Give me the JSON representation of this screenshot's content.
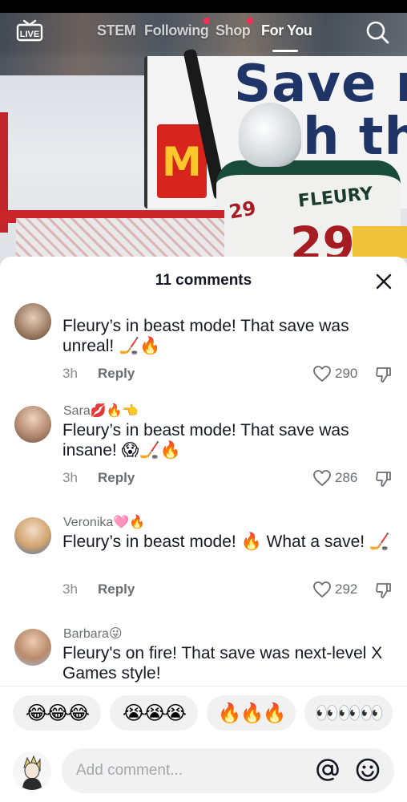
{
  "nav": {
    "live_label": "LIVE",
    "tabs": [
      {
        "label": "STEM",
        "active": false,
        "dot": false
      },
      {
        "label": "Following",
        "active": false,
        "dot": true
      },
      {
        "label": "Shop",
        "active": false,
        "dot": true
      },
      {
        "label": "For You",
        "active": true,
        "dot": false
      }
    ]
  },
  "video": {
    "board_text_1": "Save m",
    "board_text_2": "h th",
    "brand_letter": "M",
    "jersey_name": "FLEURY",
    "jersey_number": "29",
    "sleeve_number": "29"
  },
  "comments_panel": {
    "title": "11 comments",
    "input_placeholder": "Add comment...",
    "comments": [
      {
        "user": "",
        "text": "Fleury’s in beast mode! That save was unreal! 🏒🔥",
        "time": "3h",
        "reply": "Reply",
        "likes": "290"
      },
      {
        "user": "Sara💋🔥👈",
        "text": "Fleury’s in beast mode! That save was insane! 😱🏒🔥",
        "time": "3h",
        "reply": "Reply",
        "likes": "286"
      },
      {
        "user": "Veronika🩷🔥",
        "text": "Fleury’s in beast mode! 🔥 What a save! 🏒",
        "time": "3h",
        "reply": "Reply",
        "likes": "292"
      },
      {
        "user": "Barbara😜",
        "text": "Fleury's on fire! That save was next-level X Games style!",
        "time": "",
        "reply": "",
        "likes": ""
      }
    ],
    "quick_emojis": [
      "😂😂😂",
      "😭😭😭",
      "🔥🔥🔥",
      "👀👀👀"
    ]
  },
  "colors": {
    "accent": "#fe2c55",
    "text_primary": "#161823",
    "text_secondary": "#6b6d73",
    "chip_bg": "#f1f1f2"
  }
}
